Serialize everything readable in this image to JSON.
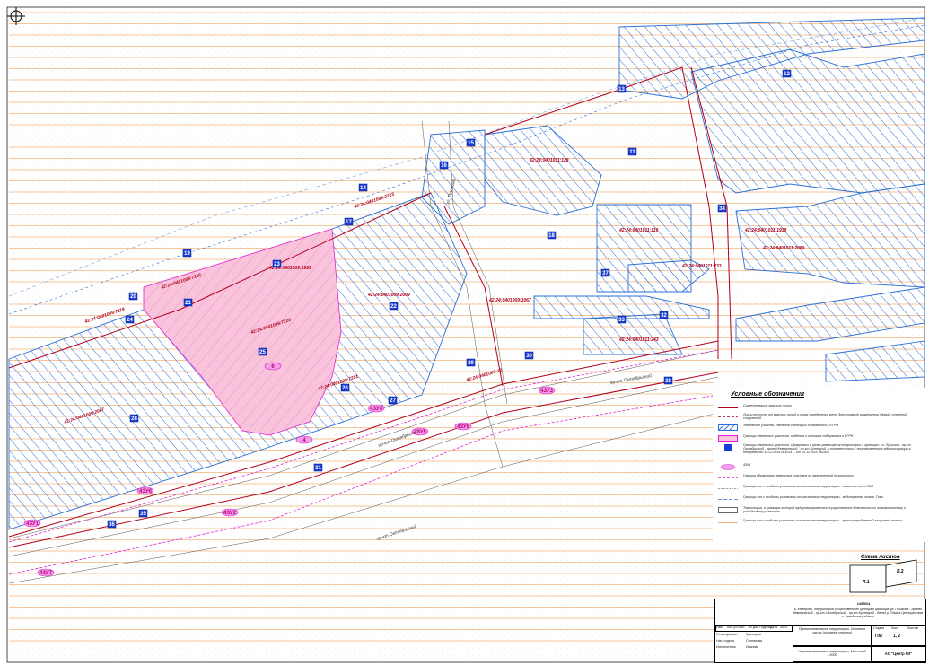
{
  "map": {
    "parcel_labels": [
      "42:24:0401009:2223",
      "42:24:0401009:7119",
      "42:24:0401009:2067",
      "42:24:0401009:7216",
      "42:24:0401009:7220",
      "42:24:0401009:1995",
      "42:24:0401009:2009",
      "42:24:0401009:7251",
      "42:24:0401011:128",
      "42:24:0401011:119",
      "42:24:0401011:1938",
      "42:24:0401011:2069",
      "42:24:0401011:233",
      "42:24:0401011:243",
      "42:24:0401009:1067",
      "42:24:0401009:12"
    ],
    "zone_numbers": [
      "11",
      "12",
      "13",
      "14",
      "15",
      "16",
      "17",
      "18",
      "19",
      "20",
      "21",
      "22",
      "23",
      "24",
      "25",
      "26",
      "27",
      "28",
      "29",
      "30",
      "31",
      "32",
      "33",
      "34",
      "35",
      "36",
      "37",
      "38",
      "39",
      "40"
    ],
    "magenta_labels": [
      "4ЗУ3",
      "4ЗУ4",
      "4ЗУ5",
      "4ЗУ6",
      "4ЗУ1",
      "4ЗУ2",
      "4ЗУ7",
      "4ЗУ8",
      "6",
      "4"
    ],
    "streets": [
      "ул. Пушкина",
      "пр-кт Октябрьский",
      "пр-кт Октябрьский",
      "пр-кт Октябрьский"
    ]
  },
  "legend": {
    "title": "Условные обозначения",
    "items": [
      "Существующие красные линии",
      "Линии отступа от красных линий в целях определения мест допустимого размещения зданий, строений, сооружений",
      "Земельные участки, сведения о которых содержатся в ЕГРН",
      "Границы земельных участков, сведения о которых содержатся в ЕГРН",
      "Границы земельных участков, образуемых в целях размещения территории в границах: ул. Пушкина - пр-кт Октябрьский - проезд Кемеровский - пр-кт Кузнецкий, в соответствии с постановлением администрации г. Кемерово от 16.12.2014 №3034 ... от 25.12.2020 №1923",
      "4ЗУ1",
      "Граница образуемых земельных участков на межселенной территории",
      "Границы зон с особыми условиями использования территории - охранные зоны ЛЭП",
      "Границы зон с особыми условиями использования территории - водоохранная зона р. Томь",
      "Территория, в границах которой предусматривается осуществление деятельности по комплексному и устойчивому развитию",
      "Граница зон с особыми условиями использования территории - граница прибрежной защитной полосы"
    ]
  },
  "scheme": {
    "title": "Схема листов",
    "sheet_a": "Л.1",
    "sheet_b": "Л.2"
  },
  "stamp": {
    "code": "14650/4",
    "address": "г. Кемерово, территория общественного центра в границах ул. Пушкина - проезд Кемеровский - пр-кт Октябрьский - пр-кт Кузнецкий - берег р. Томь в Центральном и Заводском районах",
    "header_cols": [
      "Изм.",
      "Кол.уч.",
      "Лист",
      "№ док.",
      "Подпись",
      "Дата"
    ],
    "roles": [
      "Гл.специалист",
      "Нач. отдела",
      "Исполнитель"
    ],
    "names": [
      "Кузнецова",
      "Степанова",
      "Иванова"
    ],
    "project": "Проект межевания территории. Основная часть (основной чертеж)",
    "stage_head": "Стадия",
    "sheet_head": "Лист",
    "sheets_head": "Листов",
    "stage": "ПМ",
    "sheet": "1, 2",
    "sheets": "",
    "drawing": "Чертеж межевания территории. Масштаб 1:2000",
    "org": "АО \"Центр ГИ\"",
    "year": "2023"
  },
  "colors": {
    "hatch_blue": "#2b6fd6",
    "red_line": "#b0001a",
    "pink_fill": "#f7b6d2",
    "magenta": "#e020d0",
    "orange_line": "#f2b27a",
    "river": "#9ab4e0"
  }
}
